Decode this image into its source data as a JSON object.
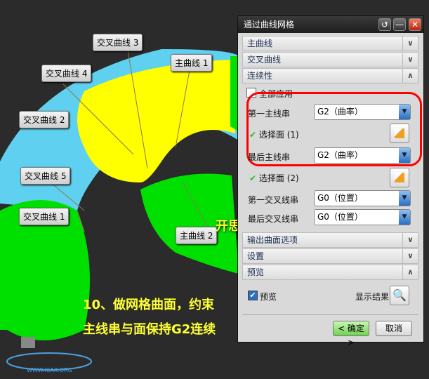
{
  "viewport": {
    "callouts": [
      "交叉曲线 3",
      "交叉曲线 4",
      "主曲线 1",
      "交叉曲线 2",
      "交叉曲线 5",
      "交叉曲线 1",
      "主曲线 2"
    ],
    "watermark": "开思网",
    "caption": [
      "10、做网格曲面，约束",
      "主线串与面保持G2连续"
    ],
    "logo_text": "WWW.ICAX.ORG",
    "colors": {
      "cyan": "#5fd0f0",
      "yellow": "#ffff00",
      "green": "#00e000",
      "caption": "#ffff33",
      "highlight": "#ff0000"
    }
  },
  "dialog": {
    "title": "通过曲线网格",
    "title_buttons": [
      "reset",
      "minimize",
      "close"
    ],
    "sections": {
      "primary": "主曲线",
      "cross": "交叉曲线",
      "continuity": "连续性",
      "output": "输出曲面选项",
      "settings": "设置",
      "preview": "预览"
    },
    "continuity": {
      "apply_all": "全部应用",
      "apply_all_checked": false,
      "first_primary_label": "第一主线串",
      "first_primary_value": "G2（曲率）",
      "select_face_1": "选择面 (1)",
      "last_primary_label": "最后主线串",
      "last_primary_value": "G2（曲率）",
      "select_face_2": "选择面 (2)",
      "first_cross_label": "第一交叉线串",
      "first_cross_value": "G0（位置）",
      "last_cross_label": "最后交叉线串",
      "last_cross_value": "G0（位置）"
    },
    "preview": {
      "checkbox": "预览",
      "checked": true,
      "show_result": "显示结果"
    },
    "ok": "< 确定 >",
    "cancel": "取消"
  }
}
